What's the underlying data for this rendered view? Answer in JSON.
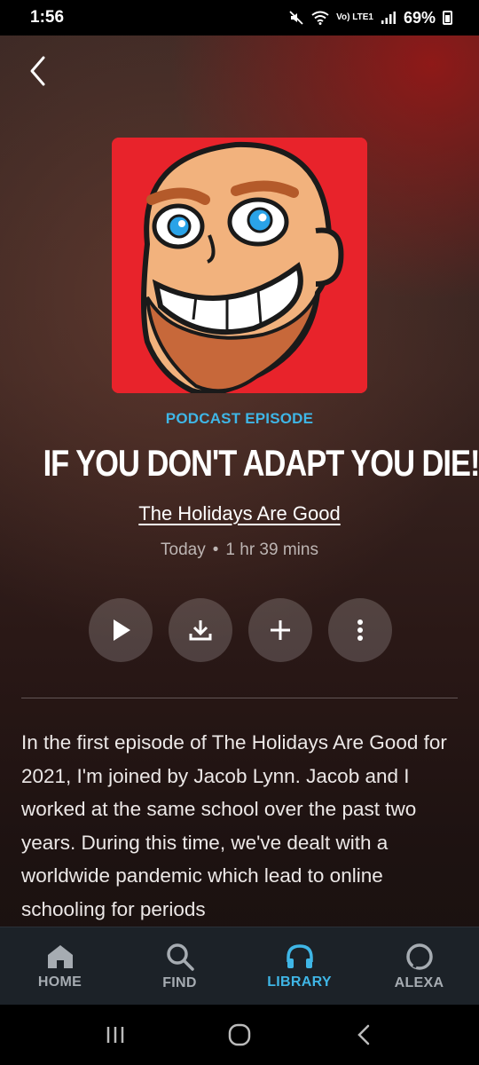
{
  "status_bar": {
    "time": "1:56",
    "network": "Vo) LTE1",
    "battery": "69%"
  },
  "episode": {
    "eyebrow": "PODCAST EPISODE",
    "title": "IF YOU DON'T ADAPT YOU DIE!",
    "show_name": "The Holidays Are Good",
    "date": "Today",
    "separator": "•",
    "duration": "1 hr 39 mins",
    "description": "In the first episode of The Holidays Are Good for 2021, I'm joined by Jacob Lynn. Jacob and I worked at the same school over the past two years. During this time, we've dealt with a worldwide pandemic which lead to online schooling for periods"
  },
  "actions": [
    {
      "name": "play-button",
      "icon": "play-icon"
    },
    {
      "name": "download-button",
      "icon": "download-icon"
    },
    {
      "name": "add-button",
      "icon": "plus-icon"
    },
    {
      "name": "more-options-button",
      "icon": "more-vertical-icon"
    }
  ],
  "bottom_nav": {
    "home": "HOME",
    "find": "FIND",
    "library": "LIBRARY",
    "alexa": "ALEXA",
    "active": "library"
  },
  "colors": {
    "accent": "#3fb6e6",
    "art_background": "#e8232b",
    "nav_background": "#1c2228"
  }
}
